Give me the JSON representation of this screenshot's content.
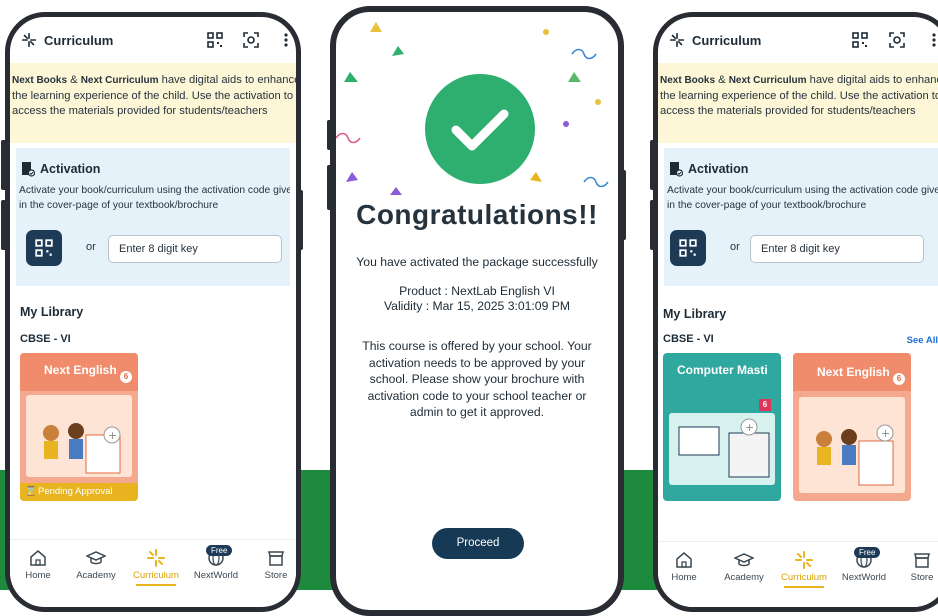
{
  "curriculum_screen": {
    "header_title": "Curriculum",
    "notice": {
      "brand_books": "Next Books",
      "amp": " & ",
      "brand_curriculum": "Next Curriculum",
      "line1_rest": " have digital aids to enhance",
      "line2": "the learning experience of the child. Use the activation to",
      "line3": "access the materials provided for students/teachers"
    },
    "activation": {
      "title": "Activation",
      "desc_line1": "Activate your book/curriculum using the activation code given",
      "desc_line2": "in the cover-page of your textbook/brochure",
      "or": "or",
      "input_placeholder": "Enter 8 digit key"
    },
    "library_title": "My Library",
    "grade": "CBSE - VI",
    "see_all": "See All",
    "books": [
      {
        "title": "Next English",
        "grade": "6",
        "status": "Pending Approval"
      },
      {
        "title": "Computer Masti",
        "grade": "6"
      },
      {
        "title": "Next English",
        "grade": "6"
      }
    ],
    "nav": [
      {
        "label": "Home",
        "icon": "home-icon"
      },
      {
        "label": "Academy",
        "icon": "graduation-cap-icon"
      },
      {
        "label": "Curriculum",
        "icon": "curriculum-icon",
        "active": true
      },
      {
        "label": "NextWorld",
        "icon": "nextworld-icon",
        "badge": "Free"
      },
      {
        "label": "Store",
        "icon": "store-icon"
      }
    ]
  },
  "congrats_screen": {
    "title": "Congratulations!!",
    "message": "You have activated the package successfully",
    "product": "Product : NextLab English VI",
    "validity": "Validity : Mar 15, 2025 3:01:09 PM",
    "info": "This course is offered by your school. Your activation needs to be approved by your school. Please show your brochure with activation code to your school teacher or admin to get it approved.",
    "proceed_label": "Proceed"
  },
  "colors": {
    "accent": "#e8b41f",
    "success": "#2eaf6f",
    "primary_dark": "#163a55",
    "background_band": "#1e8a3e"
  }
}
